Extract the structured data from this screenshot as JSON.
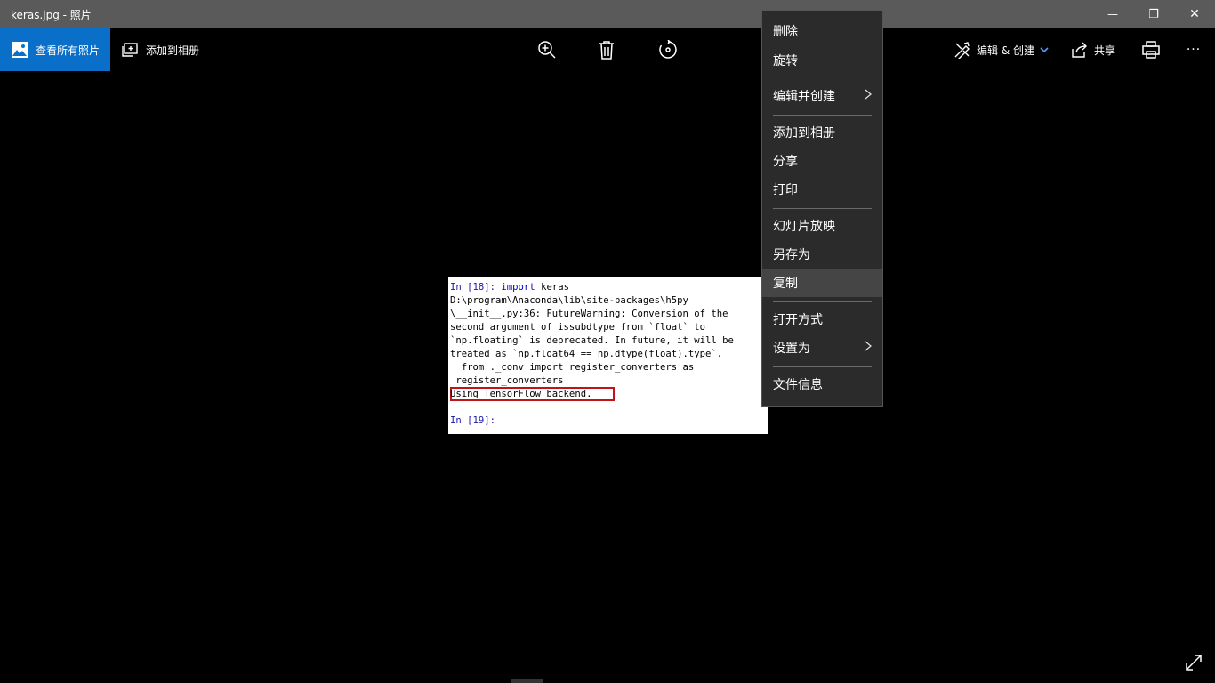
{
  "window": {
    "title": "keras.jpg - 照片",
    "minimize_glyph": "—",
    "restore_glyph": "❐",
    "close_glyph": "✕"
  },
  "toolbar": {
    "view_all_label": "查看所有照片",
    "add_to_album_label": "添加到相册",
    "edit_create_label": "编辑 & 创建",
    "share_label": "共享",
    "more_glyph": "···",
    "icons": [
      "photos-icon",
      "add-to-album-icon",
      "zoom-in-icon",
      "delete-icon",
      "rotate-icon",
      "edit-create-icon",
      "share-icon",
      "print-icon",
      "more-icon"
    ]
  },
  "photo": {
    "lines": [
      {
        "parts": [
          [
            "In [",
            "p"
          ],
          [
            "18",
            "p"
          ],
          [
            "]: ",
            "p"
          ],
          [
            "import",
            "b"
          ],
          [
            " keras",
            "n"
          ]
        ]
      },
      {
        "parts": [
          [
            "D:\\program\\Anaconda\\lib\\site-packages\\h5py",
            "n"
          ]
        ]
      },
      {
        "parts": [
          [
            "\\__init__.py:36: FutureWarning: Conversion of the",
            "n"
          ]
        ]
      },
      {
        "parts": [
          [
            "second argument of issubdtype from `float` to",
            "n"
          ]
        ]
      },
      {
        "parts": [
          [
            "`np.floating` is deprecated. In future, it will be",
            "n"
          ]
        ]
      },
      {
        "parts": [
          [
            "treated as `np.float64 == np.dtype(float).type`.",
            "n"
          ]
        ]
      },
      {
        "parts": [
          [
            "  from ._conv import register_converters as",
            "n"
          ]
        ]
      },
      {
        "parts": [
          [
            " register_converters",
            "n"
          ]
        ]
      },
      {
        "parts": [
          [
            "Using TensorFlow backend.",
            "n"
          ]
        ]
      },
      {
        "parts": [
          [
            "",
            "n"
          ]
        ]
      },
      {
        "parts": [
          [
            "In [",
            "p"
          ],
          [
            "19",
            "p"
          ],
          [
            "]:",
            "p"
          ]
        ]
      }
    ]
  },
  "context_menu": {
    "items": [
      {
        "label": "删除",
        "submenu": false
      },
      {
        "label": "旋转",
        "submenu": false
      },
      {
        "label": "编辑并创建",
        "submenu": true
      },
      {
        "label": "添加到相册",
        "submenu": false
      },
      {
        "label": "分享",
        "submenu": false
      },
      {
        "label": "打印",
        "submenu": false
      },
      {
        "label": "幻灯片放映",
        "submenu": false
      },
      {
        "label": "另存为",
        "submenu": false
      },
      {
        "label": "复制",
        "submenu": false,
        "hovered": true
      },
      {
        "label": "打开方式",
        "submenu": false
      },
      {
        "label": "设置为",
        "submenu": true
      },
      {
        "label": "文件信息",
        "submenu": false
      }
    ],
    "submenu_glyph": "〉"
  },
  "colors": {
    "accent": "#0a6fc9",
    "titlebar": "#5a5a5a",
    "menu_bg": "#2b2b2b",
    "menu_hover": "#454545",
    "highlight_box": "#c0141a"
  }
}
